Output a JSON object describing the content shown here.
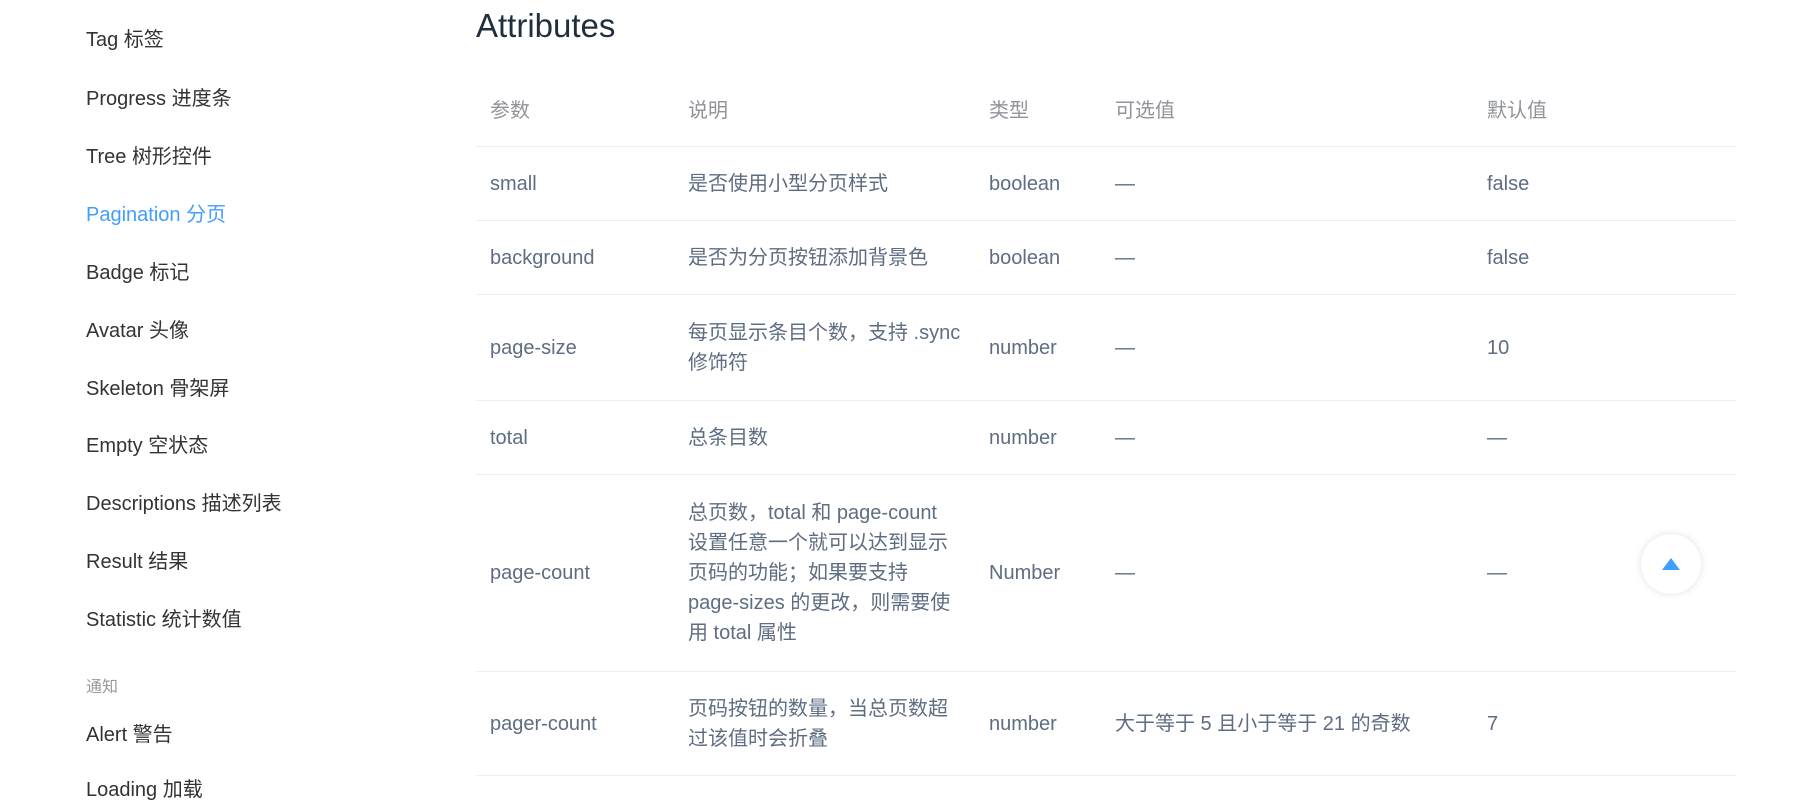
{
  "sidebar": {
    "items": [
      {
        "label": "Tag 标签",
        "active": false
      },
      {
        "label": "Progress 进度条",
        "active": false
      },
      {
        "label": "Tree 树形控件",
        "active": false
      },
      {
        "label": "Pagination 分页",
        "active": true
      },
      {
        "label": "Badge 标记",
        "active": false
      },
      {
        "label": "Avatar 头像",
        "active": false
      },
      {
        "label": "Skeleton 骨架屏",
        "active": false
      },
      {
        "label": "Empty 空状态",
        "active": false
      },
      {
        "label": "Descriptions 描述列表",
        "active": false
      },
      {
        "label": "Result 结果",
        "active": false
      },
      {
        "label": "Statistic 统计数值",
        "active": false
      }
    ],
    "group_label": "通知",
    "group_items": [
      {
        "label": "Alert 警告"
      },
      {
        "label": "Loading 加载"
      }
    ]
  },
  "main": {
    "title": "Attributes",
    "table": {
      "headers": [
        "参数",
        "说明",
        "类型",
        "可选值",
        "默认值"
      ],
      "rows": [
        [
          "small",
          "是否使用小型分页样式",
          "boolean",
          "—",
          "false"
        ],
        [
          "background",
          "是否为分页按钮添加背景色",
          "boolean",
          "—",
          "false"
        ],
        [
          "page-size",
          "每页显示条目个数，支持 .sync 修饰符",
          "number",
          "—",
          "10"
        ],
        [
          "total",
          "总条目数",
          "number",
          "—",
          "—"
        ],
        [
          "page-count",
          "总页数，total 和 page-count 设置任意一个就可以达到显示页码的功能；如果要支持 page-sizes 的更改，则需要使用 total 属性",
          "Number",
          "—",
          "—"
        ],
        [
          "pager-count",
          "页码按钮的数量，当总页数超过该值时会折叠",
          "number",
          "大于等于 5 且小于等于 21 的奇数",
          "7"
        ]
      ]
    }
  },
  "back_to_top": {
    "icon": "caret-up-icon"
  },
  "colors": {
    "accent": "#409eff",
    "text": "#333333",
    "muted": "#909399",
    "border": "#eaeefb",
    "title": "#1f2f3d"
  }
}
